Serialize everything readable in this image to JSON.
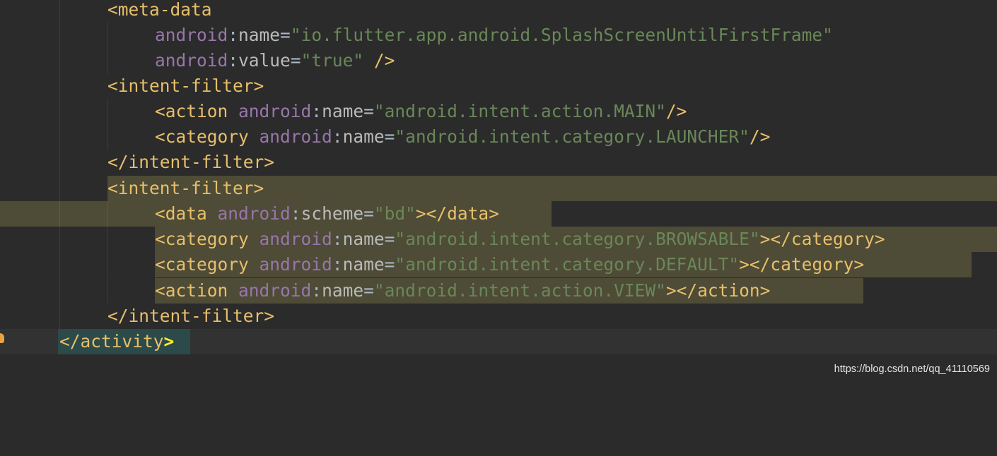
{
  "editor": {
    "language": "xml",
    "colors": {
      "background": "#2b2b2b",
      "tag": "#e8bf6a",
      "namespace": "#9876aa",
      "attribute": "#bababa",
      "value": "#6a8759",
      "selection_highlight": "#4e4b36",
      "brace_match": "#2c4a4a"
    },
    "lines": [
      {
        "open": "<meta-data"
      },
      {
        "ns": "android",
        "attr": "name",
        "value": "\"io.flutter.app.android.SplashScreenUntilFirstFrame\""
      },
      {
        "ns": "android",
        "attr": "value",
        "value": "\"true\"",
        "close": " />"
      },
      {
        "open": "<intent-filter",
        "close": ">"
      },
      {
        "open": "<action",
        "ns": "android",
        "attr": "name",
        "value": "\"android.intent.action.MAIN\"",
        "close": "/>"
      },
      {
        "open": "<category",
        "ns": "android",
        "attr": "name",
        "value": "\"android.intent.category.LAUNCHER\"",
        "close": "/>"
      },
      {
        "open": "</intent-filter",
        "close": ">"
      },
      {
        "open": "<intent-filter",
        "close": ">"
      },
      {
        "open": "<data",
        "ns": "android",
        "attr": "scheme",
        "value": "\"bd\"",
        "close": "></data>"
      },
      {
        "open": "<category",
        "ns": "android",
        "attr": "name",
        "value": "\"android.intent.category.BROWSABLE\"",
        "close": "></category>"
      },
      {
        "open": "<category",
        "ns": "android",
        "attr": "name",
        "value": "\"android.intent.category.DEFAULT\"",
        "close": "></category>"
      },
      {
        "open": "<action",
        "ns": "android",
        "attr": "name",
        "value": "\"android.intent.action.VIEW\"",
        "close": "></action>"
      },
      {
        "open": "</intent-filter",
        "close": ">"
      },
      {
        "open": "</activity",
        "close": ">"
      }
    ]
  },
  "gutter": {
    "icon": "lightbulb-icon"
  },
  "watermark": "https://blog.csdn.net/qq_41110569"
}
